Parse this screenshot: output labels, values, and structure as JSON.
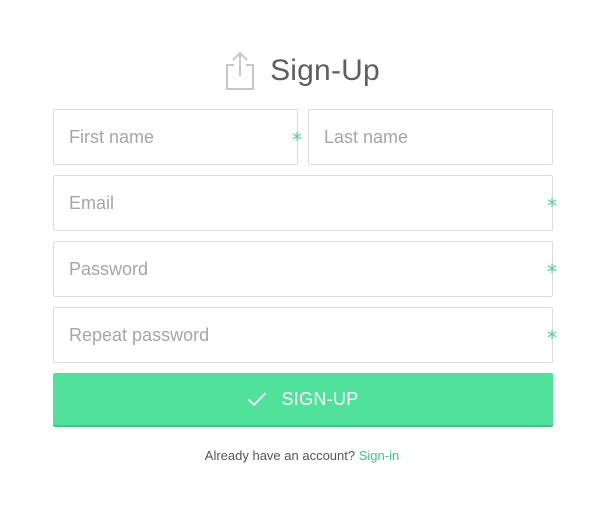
{
  "header": {
    "title": "Sign-Up",
    "icon": "upload-icon"
  },
  "form": {
    "first_name": {
      "placeholder": "First name",
      "value": "",
      "required_marker": "*"
    },
    "last_name": {
      "placeholder": "Last name",
      "value": ""
    },
    "email": {
      "placeholder": "Email",
      "value": "",
      "required_marker": "*"
    },
    "password": {
      "placeholder": "Password",
      "value": "",
      "required_marker": "*"
    },
    "repeat_password": {
      "placeholder": "Repeat password",
      "value": "",
      "required_marker": "*"
    },
    "submit": {
      "label": "SIGN-UP",
      "icon": "check-icon"
    }
  },
  "footer": {
    "prompt_text": "Already have an account?",
    "signin_link": "Sign-in"
  },
  "colors": {
    "accent": "#50e19a",
    "link": "#3cc882",
    "required": "#4fd497",
    "border": "#dcdcdc",
    "placeholder": "#a6a6a6"
  }
}
